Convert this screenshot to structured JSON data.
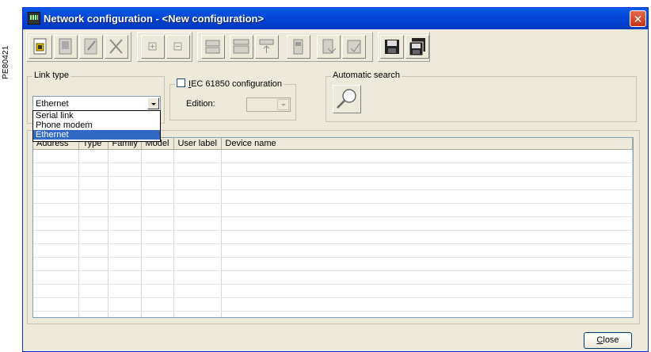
{
  "side_ref": "PE80421",
  "window": {
    "title": "Network configuration - <New configuration>"
  },
  "toolbar": {
    "buttons": [
      "new-network-icon",
      "device-icon",
      "properties-icon",
      "delete-icon",
      "expand-icon",
      "collapse-icon",
      "connect-icon",
      "connect-all-icon",
      "upload-icon",
      "setup-icon",
      "read-icon",
      "write-icon",
      "save-icon",
      "save-as-icon"
    ]
  },
  "link_type": {
    "legend": "Link type",
    "selected": "Ethernet",
    "options": [
      "Serial link",
      "Phone modem",
      "Ethernet"
    ]
  },
  "iec": {
    "checkbox_label": "IEC 61850 configuration",
    "edition_label": "Edition:",
    "edition_value": ""
  },
  "auto_search": {
    "legend": "Automatic search"
  },
  "table": {
    "columns": [
      "Address",
      "Type",
      "Family",
      "Model",
      "User label",
      "Device name"
    ],
    "rows": 13
  },
  "buttons": {
    "close": "Close"
  }
}
